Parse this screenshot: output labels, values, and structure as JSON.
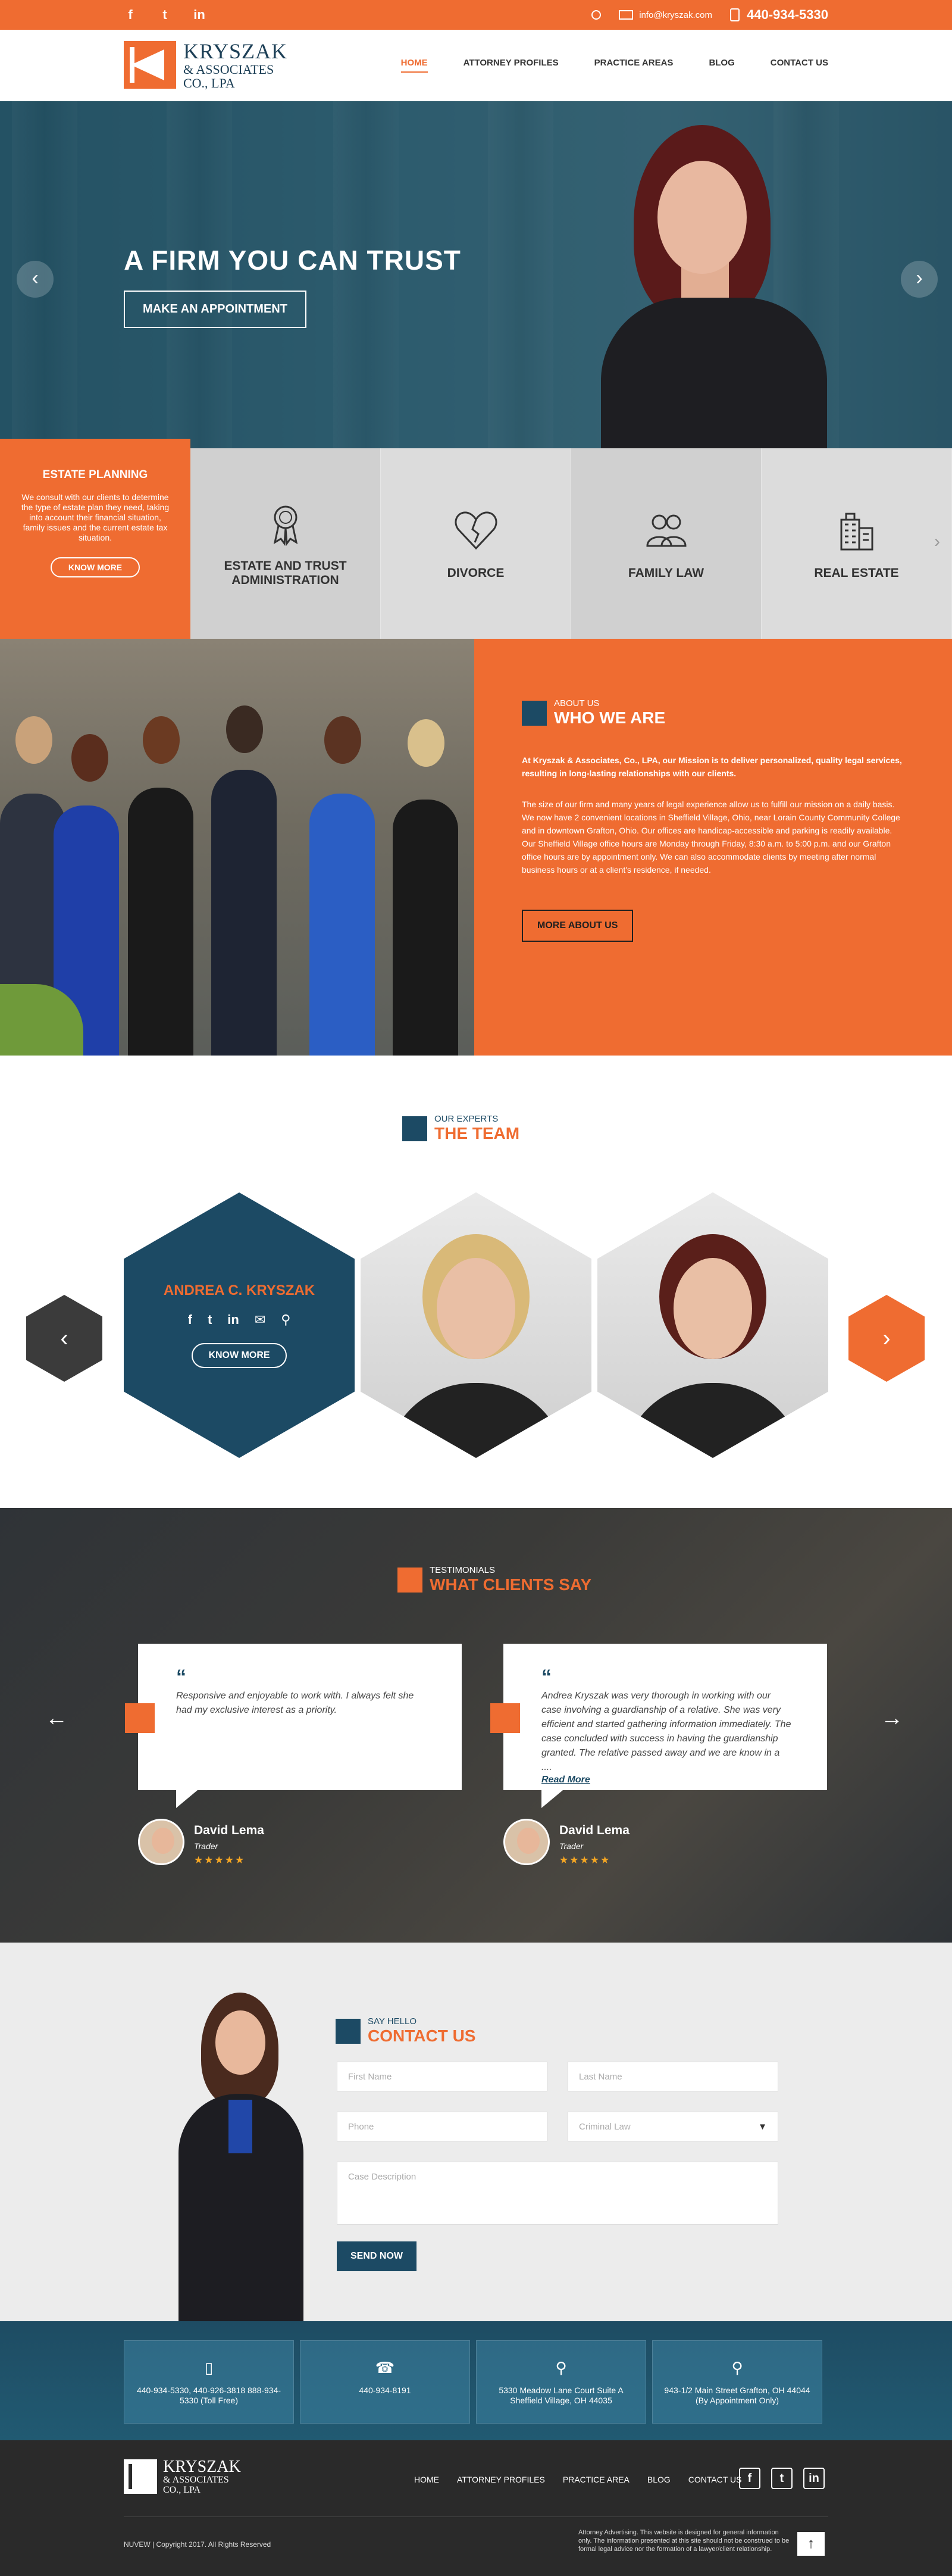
{
  "topbar": {
    "social": [
      "f",
      "t",
      "in"
    ],
    "email": "info@kryszak.com",
    "phone": "440-934-5330",
    "search_icon": "search-icon",
    "email_icon": "envelope-icon",
    "phone_icon": "mobile-icon"
  },
  "logo": {
    "line1": "KRYSZAK",
    "line2": "& ASSOCIATES",
    "line3": "CO., LPA"
  },
  "nav": {
    "items": [
      {
        "label": "HOME",
        "active": true
      },
      {
        "label": "ATTORNEY PROFILES"
      },
      {
        "label": "PRACTICE AREAS"
      },
      {
        "label": "BLOG"
      },
      {
        "label": "CONTACT US"
      }
    ]
  },
  "hero": {
    "title": "A FIRM YOU CAN TRUST",
    "cta": "MAKE AN APPOINTMENT",
    "prev": "‹",
    "next": "›"
  },
  "practice": {
    "feature": {
      "title": "ESTATE PLANNING",
      "text": "We consult with our clients to determine the type of estate plan they need, taking into account their financial situation, family issues and the current estate tax situation.",
      "button": "KNOW MORE"
    },
    "tiles": [
      {
        "label": "ESTATE AND TRUST ADMINISTRATION",
        "icon": "award-ribbon-icon"
      },
      {
        "label": "DIVORCE",
        "icon": "broken-heart-icon"
      },
      {
        "label": "FAMILY LAW",
        "icon": "family-group-icon"
      },
      {
        "label": "REAL ESTATE",
        "icon": "buildings-icon"
      }
    ]
  },
  "about": {
    "kicker": "ABOUT US",
    "title": "WHO WE ARE",
    "lead": "At Kryszak & Associates, Co., LPA, our Mission is to deliver personalized, quality legal services, resulting in long-lasting relationships with our clients.",
    "body": "The size of our firm and many years of legal experience allow us to fulfill our mission on a daily basis. We now have 2 convenient locations in Sheffield Village, Ohio, near Lorain County Community College and in downtown Grafton, Ohio. Our offices are handicap-accessible and parking is readily available. Our Sheffield Village office hours are Monday through Friday, 8:30 a.m. to 5:00 p.m. and our Grafton office hours are by appointment only. We can also accommodate clients by meeting after normal business hours or at a client's residence, if needed.",
    "button": "MORE ABOUT US"
  },
  "team": {
    "kicker": "OUR EXPERTS",
    "title": "THE TEAM",
    "featured": {
      "name": "ANDREA C. KRYSZAK",
      "icons": [
        "f",
        "t",
        "in",
        "✉",
        "⚲"
      ],
      "button": "KNOW MORE"
    },
    "prev": "‹",
    "next": "›"
  },
  "testimonials": {
    "kicker": "TESTIMONIALS",
    "title": "WHAT CLIENTS SAY",
    "prev": "←",
    "next": "→",
    "items": [
      {
        "quote": "Responsive and enjoyable to work with. I always felt she had my exclusive interest as a priority.",
        "more": "",
        "name": "David Lema",
        "role": "Trader",
        "stars": "★★★★★"
      },
      {
        "quote": "Andrea Kryszak was very thorough in working with our case involving a guardianship of a relative. She was very efficient and started gathering information immediately. The case concluded with success in having the guardianship granted. The relative passed away and we are know in a ....",
        "more": "Read More",
        "name": "David Lema",
        "role": "Trader",
        "stars": "★★★★★"
      }
    ]
  },
  "contact": {
    "kicker": "SAY HELLO",
    "title": "CONTACT US",
    "first_name": "First Name",
    "last_name": "Last Name",
    "phone": "Phone",
    "practice": "Criminal Law",
    "description": "Case Description",
    "button": "SEND NOW"
  },
  "info": [
    {
      "icon": "▯",
      "text": "440-934-5330, 440-926-3818 888-934-5330 (Toll Free)"
    },
    {
      "icon": "☎",
      "text": "440-934-8191"
    },
    {
      "icon": "⚲",
      "text": "5330 Meadow Lane Court Suite A Sheffield Village, OH 44035"
    },
    {
      "icon": "⚲",
      "text": "943-1/2 Main Street Grafton, OH 44044 (By Appointment Only)"
    }
  ],
  "footer": {
    "logo_line1": "KRYSZAK",
    "logo_line2": "& ASSOCIATES",
    "logo_line3": "CO., LPA",
    "nav": [
      "HOME",
      "ATTORNEY PROFILES",
      "PRACTICE AREA",
      "BLOG",
      "CONTACT US"
    ],
    "social": [
      "f",
      "t",
      "in"
    ],
    "copyright": "NUVEW | Copyright 2017. All Rights Reserved",
    "disclaimer": "Attorney Advertising. This website is designed for general information only. The information presented at this site should not be construed to be formal legal advice nor the formation of a lawyer/client relationship.",
    "up": "↑"
  }
}
